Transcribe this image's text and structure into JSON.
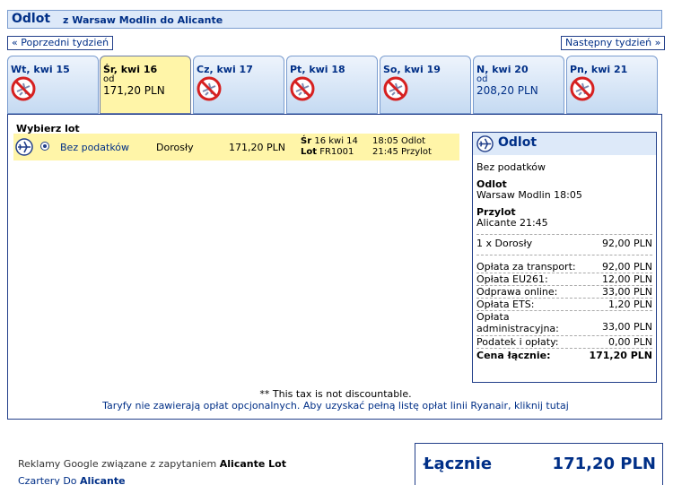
{
  "header": {
    "title": "Odlot",
    "route": "z Warsaw Modlin do Alicante"
  },
  "nav": {
    "prev": "« Poprzedni tydzień",
    "next": "Następny tydzień »"
  },
  "days": [
    {
      "label": "Wt, kwi 15",
      "available": false
    },
    {
      "label": "Śr, kwi 16",
      "available": true,
      "from": "od",
      "price": "171,20 PLN",
      "selected": true
    },
    {
      "label": "Cz, kwi 17",
      "available": false
    },
    {
      "label": "Pt, kwi 18",
      "available": false
    },
    {
      "label": "So, kwi 19",
      "available": false
    },
    {
      "label": "N, kwi 20",
      "available": true,
      "from": "od",
      "price": "208,20 PLN",
      "selected": false
    },
    {
      "label": "Pn, kwi 21",
      "available": false
    }
  ],
  "select_label": "Wybierz lot",
  "flight_row": {
    "fare": "Bez podatków",
    "passenger": "Dorosły",
    "price": "171,20 PLN",
    "date_day": "Śr",
    "date_rest": "16 kwi 14",
    "flight_label": "Lot",
    "flight_no": "FR1001",
    "depart": "18:05 Odlot",
    "arrive": "21:45 Przylot"
  },
  "summary": {
    "title": "Odlot",
    "fare": "Bez podatków",
    "depart_label": "Odlot",
    "depart_value": "Warsaw Modlin 18:05",
    "arrive_label": "Przylot",
    "arrive_value": "Alicante 21:45",
    "pax_line": "1 x Dorosły",
    "pax_price": "92,00 PLN",
    "fees": [
      {
        "label": "Opłata za transport:",
        "value": "92,00 PLN"
      },
      {
        "label": "Opłata EU261:",
        "value": "12,00 PLN"
      },
      {
        "label": "Odprawa online:",
        "value": "33,00 PLN"
      },
      {
        "label": "Opłata ETS:",
        "value": "1,20 PLN"
      },
      {
        "label": "Opłata administracyjna:",
        "value": "33,00 PLN"
      },
      {
        "label": "Podatek i opłaty:",
        "value": "0,00 PLN"
      }
    ],
    "total_label": "Cena łącznie:",
    "total_value": "171,20 PLN"
  },
  "footnote": "** This tax is not discountable.",
  "fees_link": "Taryfy nie zawierają opłat opcjonalnych. Aby uzyskać pełną listę opłat linii Ryanair, kliknij tutaj",
  "ads": {
    "prefix": "Reklamy Google związane z zapytaniem",
    "query": "Alicante Lot",
    "link_prefix": "Czartery Do",
    "link_bold": "Alicante"
  },
  "grand_total": {
    "label": "Łącznie",
    "value": "171,20 PLN"
  }
}
